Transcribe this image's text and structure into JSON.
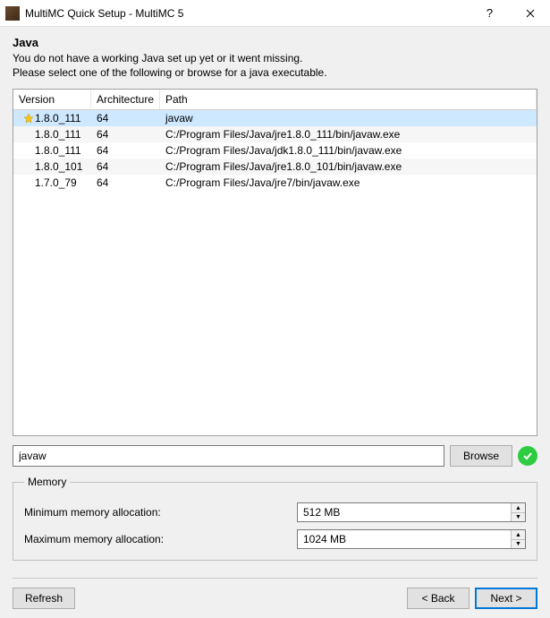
{
  "window": {
    "title": "MultiMC Quick Setup - MultiMC 5"
  },
  "section": {
    "heading": "Java",
    "line1": "You do not have a working Java set up yet or it went missing.",
    "line2": "Please select one of the following or browse for a java executable."
  },
  "columns": {
    "version": "Version",
    "arch": "Architecture",
    "path": "Path"
  },
  "rows": [
    {
      "starred": true,
      "version": "1.8.0_111",
      "arch": "64",
      "path": "javaw",
      "selected": true
    },
    {
      "starred": false,
      "version": "1.8.0_111",
      "arch": "64",
      "path": "C:/Program Files/Java/jre1.8.0_111/bin/javaw.exe",
      "selected": false
    },
    {
      "starred": false,
      "version": "1.8.0_111",
      "arch": "64",
      "path": "C:/Program Files/Java/jdk1.8.0_111/bin/javaw.exe",
      "selected": false
    },
    {
      "starred": false,
      "version": "1.8.0_101",
      "arch": "64",
      "path": "C:/Program Files/Java/jre1.8.0_101/bin/javaw.exe",
      "selected": false
    },
    {
      "starred": false,
      "version": "1.7.0_79",
      "arch": "64",
      "path": "C:/Program Files/Java/jre7/bin/javaw.exe",
      "selected": false
    }
  ],
  "pathField": {
    "value": "javaw"
  },
  "buttons": {
    "browse": "Browse",
    "refresh": "Refresh",
    "back": "< Back",
    "next": "Next >"
  },
  "memory": {
    "legend": "Memory",
    "minLabel": "Minimum memory allocation:",
    "maxLabel": "Maximum memory allocation:",
    "minValue": "512 MB",
    "maxValue": "1024 MB"
  }
}
